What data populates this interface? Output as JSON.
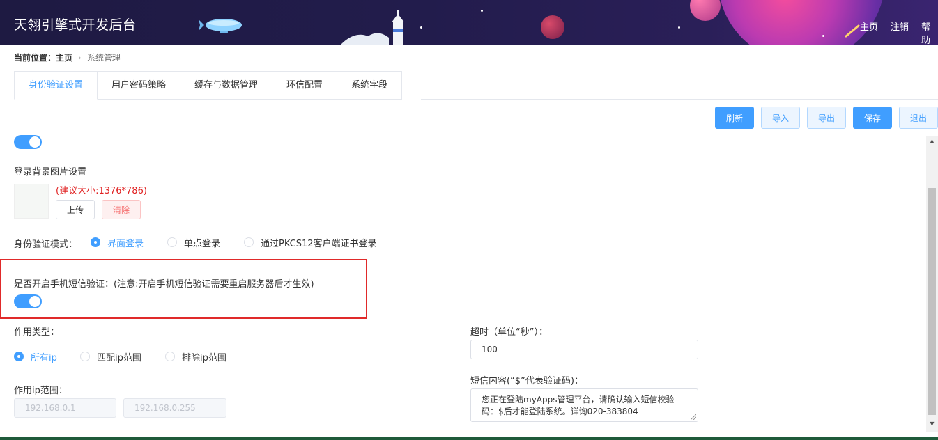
{
  "header": {
    "title": "天翎引擎式开发后台",
    "nav": [
      "主页",
      "注销",
      "帮助"
    ]
  },
  "breadcrumb": {
    "prefix": "当前位置：",
    "home": "主页",
    "current": "系统管理"
  },
  "tabs": [
    {
      "label": "身份验证设置",
      "active": true
    },
    {
      "label": "用户密码策略",
      "active": false
    },
    {
      "label": "缓存与数据管理",
      "active": false
    },
    {
      "label": "环信配置",
      "active": false
    },
    {
      "label": "系统字段",
      "active": false
    }
  ],
  "toolbar": {
    "refresh": "刷新",
    "import": "导入",
    "export": "导出",
    "save": "保存",
    "exit": "退出"
  },
  "login_bg": {
    "label": "登录背景图片设置",
    "hint": "(建议大小:1376*786)",
    "upload": "上传",
    "clear": "清除"
  },
  "auth_mode": {
    "label": "身份验证模式：",
    "options": [
      {
        "label": "界面登录",
        "checked": true
      },
      {
        "label": "单点登录",
        "checked": false
      },
      {
        "label": "通过PKCS12客户端证书登录",
        "checked": false
      }
    ]
  },
  "sms": {
    "label": "是否开启手机短信验证：(注意:开启手机短信验证需要重启服务器后才生效)",
    "enabled": true
  },
  "scope_type": {
    "label": "作用类型：",
    "options": [
      {
        "label": "所有ip",
        "checked": true
      },
      {
        "label": "匹配ip范围",
        "checked": false
      },
      {
        "label": "排除ip范围",
        "checked": false
      }
    ]
  },
  "ip_range": {
    "label": "作用ip范围：",
    "start": "192.168.0.1",
    "end": "192.168.0.255"
  },
  "timeout": {
    "label": "超时（单位“秒”）：",
    "value": "100"
  },
  "sms_content": {
    "label": "短信内容(“$”代表验证码)：",
    "value": "您正在登陆myApps管理平台，请确认输入短信校验码：$后才能登陆系统。详询020-383804"
  },
  "colors": {
    "primary": "#409eff",
    "danger": "#e02020",
    "header_bg": "#1e1a42"
  }
}
